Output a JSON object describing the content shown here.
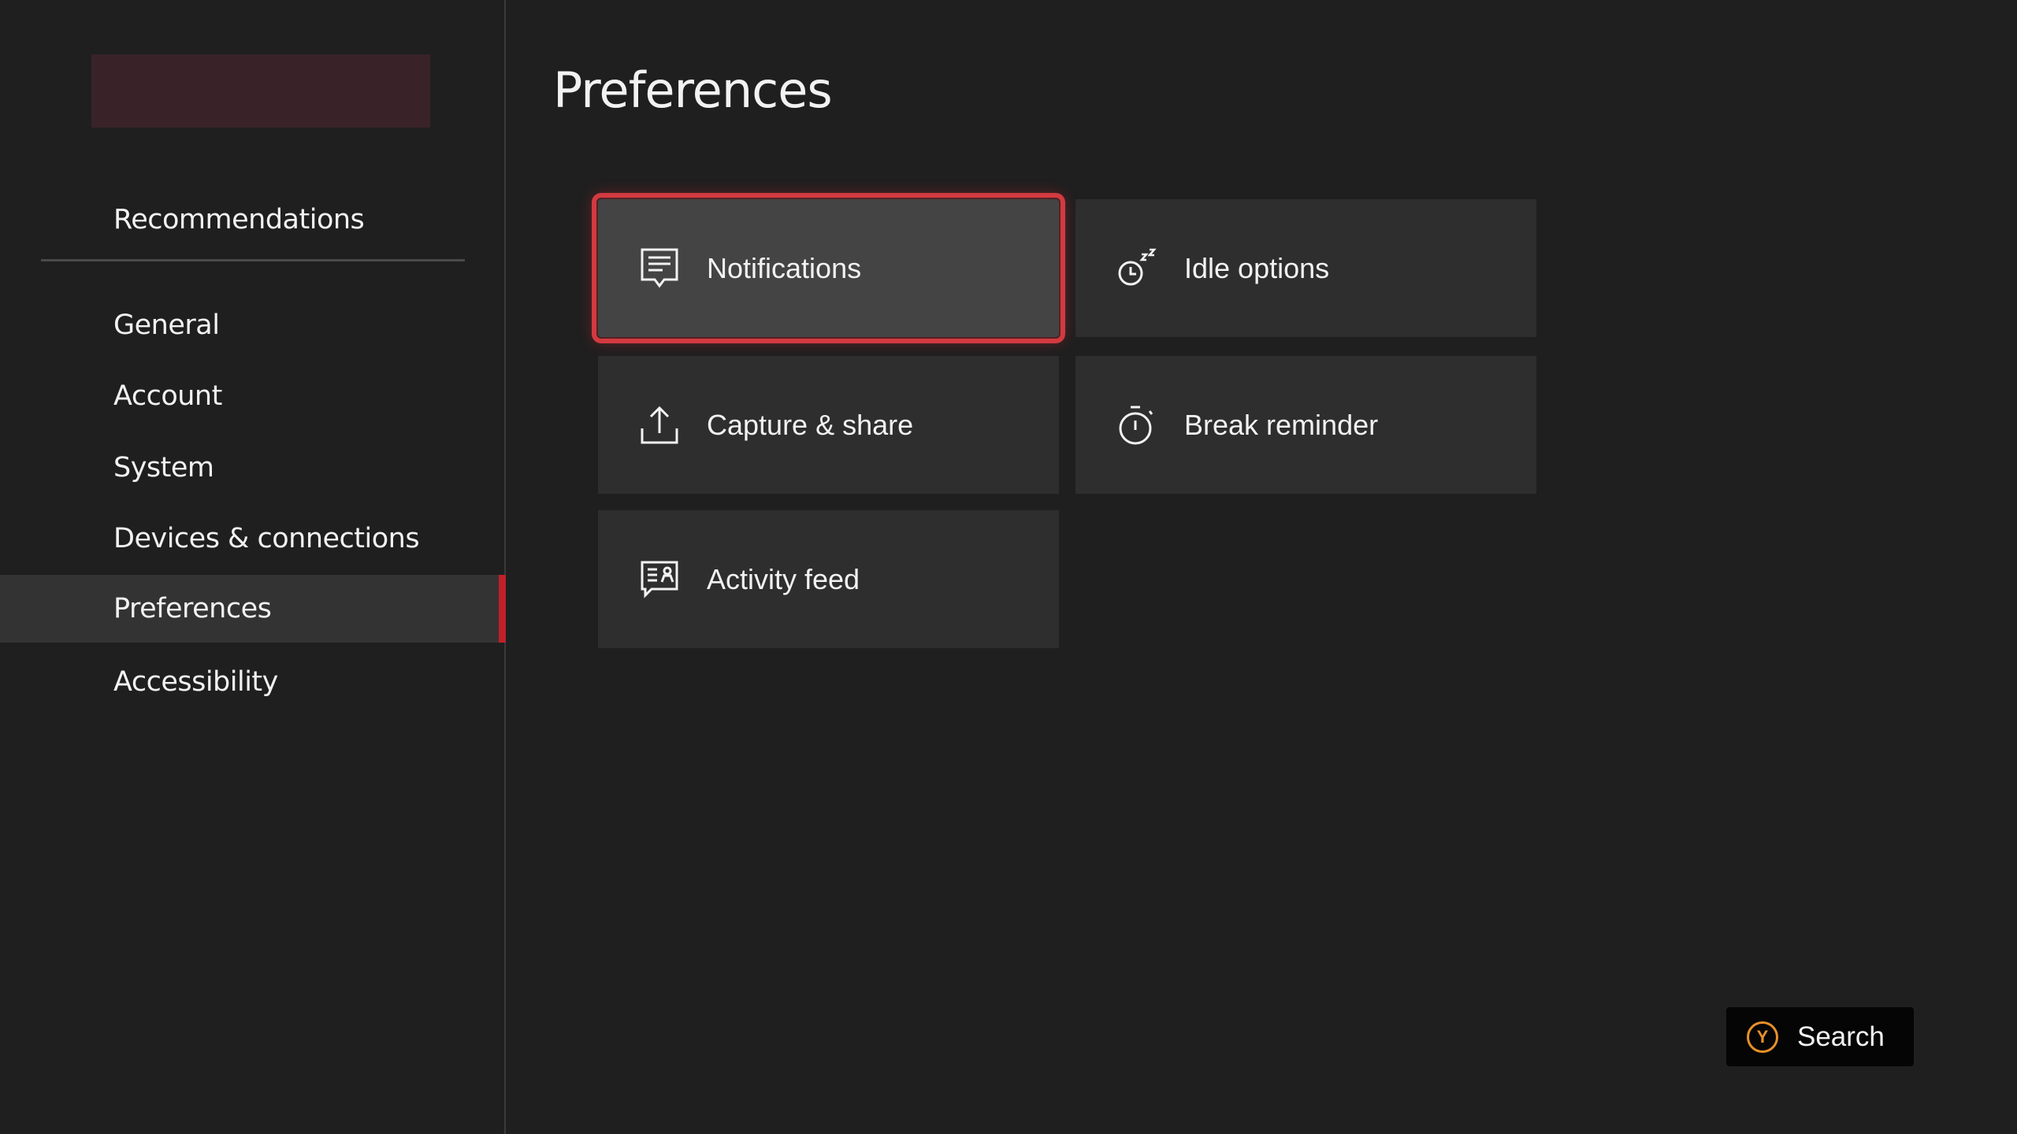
{
  "sidebar": {
    "recommendations": "Recommendations",
    "items": [
      {
        "label": "General"
      },
      {
        "label": "Account"
      },
      {
        "label": "System"
      },
      {
        "label": "Devices & connections"
      },
      {
        "label": "Preferences",
        "active": true
      },
      {
        "label": "Accessibility"
      }
    ]
  },
  "main": {
    "title": "Preferences",
    "tiles": [
      {
        "label": "Notifications",
        "icon": "notification-message-icon",
        "focused": true
      },
      {
        "label": "Idle options",
        "icon": "idle-clock-zzz-icon"
      },
      {
        "label": "Capture & share",
        "icon": "upload-share-icon"
      },
      {
        "label": "Break reminder",
        "icon": "stopwatch-icon"
      },
      {
        "label": "Activity feed",
        "icon": "activity-feed-icon"
      }
    ]
  },
  "footer": {
    "search_label": "Search",
    "search_button_glyph": "Y"
  },
  "colors": {
    "accent": "#c0202a",
    "focus_border": "#d23a40",
    "y_button": "#e8902a",
    "background": "#1f1f1f",
    "tile": "#2e2e2e"
  }
}
